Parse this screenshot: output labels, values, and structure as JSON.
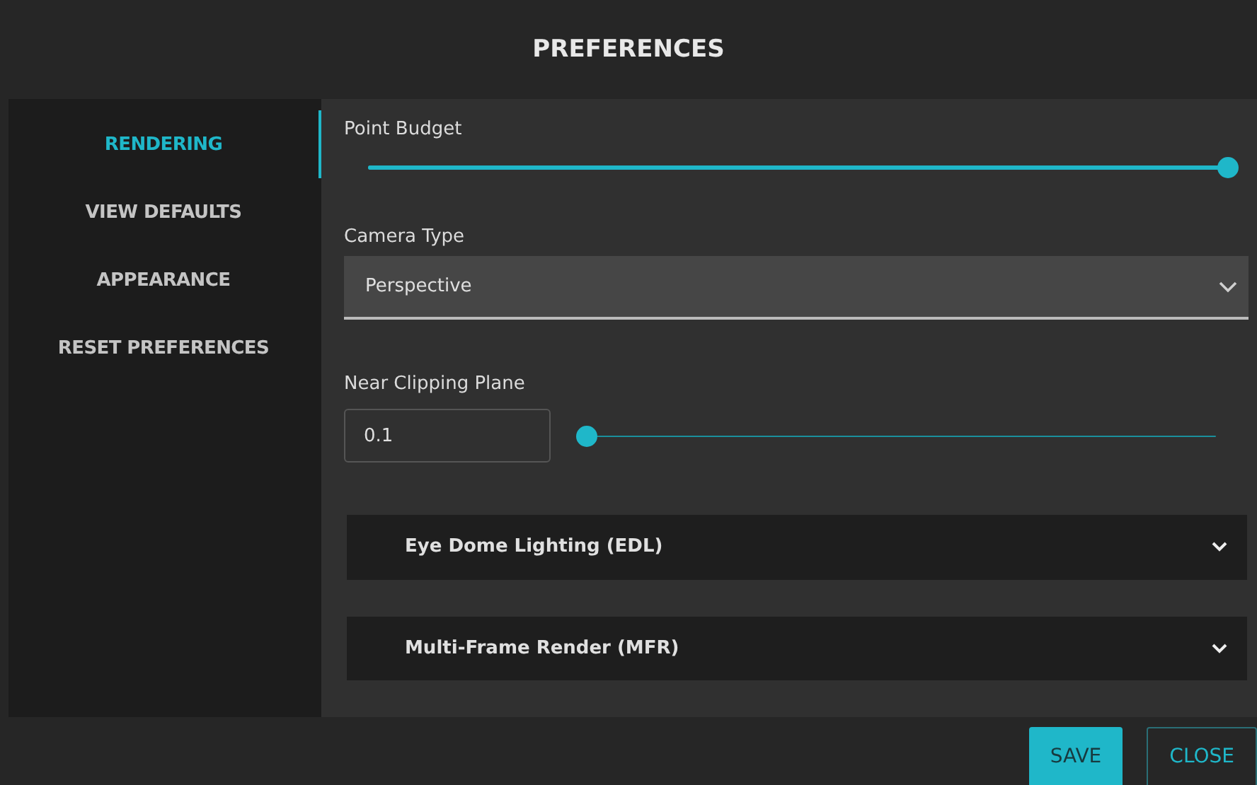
{
  "window": {
    "title": "PREFERENCES"
  },
  "sidebar": {
    "items": [
      {
        "label": "RENDERING",
        "selected": true
      },
      {
        "label": "VIEW DEFAULTS",
        "selected": false
      },
      {
        "label": "APPEARANCE",
        "selected": false
      },
      {
        "label": "RESET PREFERENCES",
        "selected": false
      }
    ]
  },
  "settings": [
    {
      "kind": "slider",
      "label": "Point Budget",
      "level": 1
    },
    {
      "kind": "select",
      "label": "Camera Type",
      "value": "Perspective"
    },
    {
      "kind": "number_slider",
      "label": "Near Clipping Plane",
      "value": "0.1",
      "level": 0
    },
    {
      "kind": "accordion",
      "label": "Eye Dome Lighting (EDL)",
      "expanded": false
    },
    {
      "kind": "accordion",
      "label": "Multi-Frame Render (MFR)",
      "expanded": false
    }
  ],
  "buttons": [
    {
      "label": "SAVE",
      "kind": "primary"
    },
    {
      "label": "CLOSE",
      "kind": "outline"
    }
  ]
}
